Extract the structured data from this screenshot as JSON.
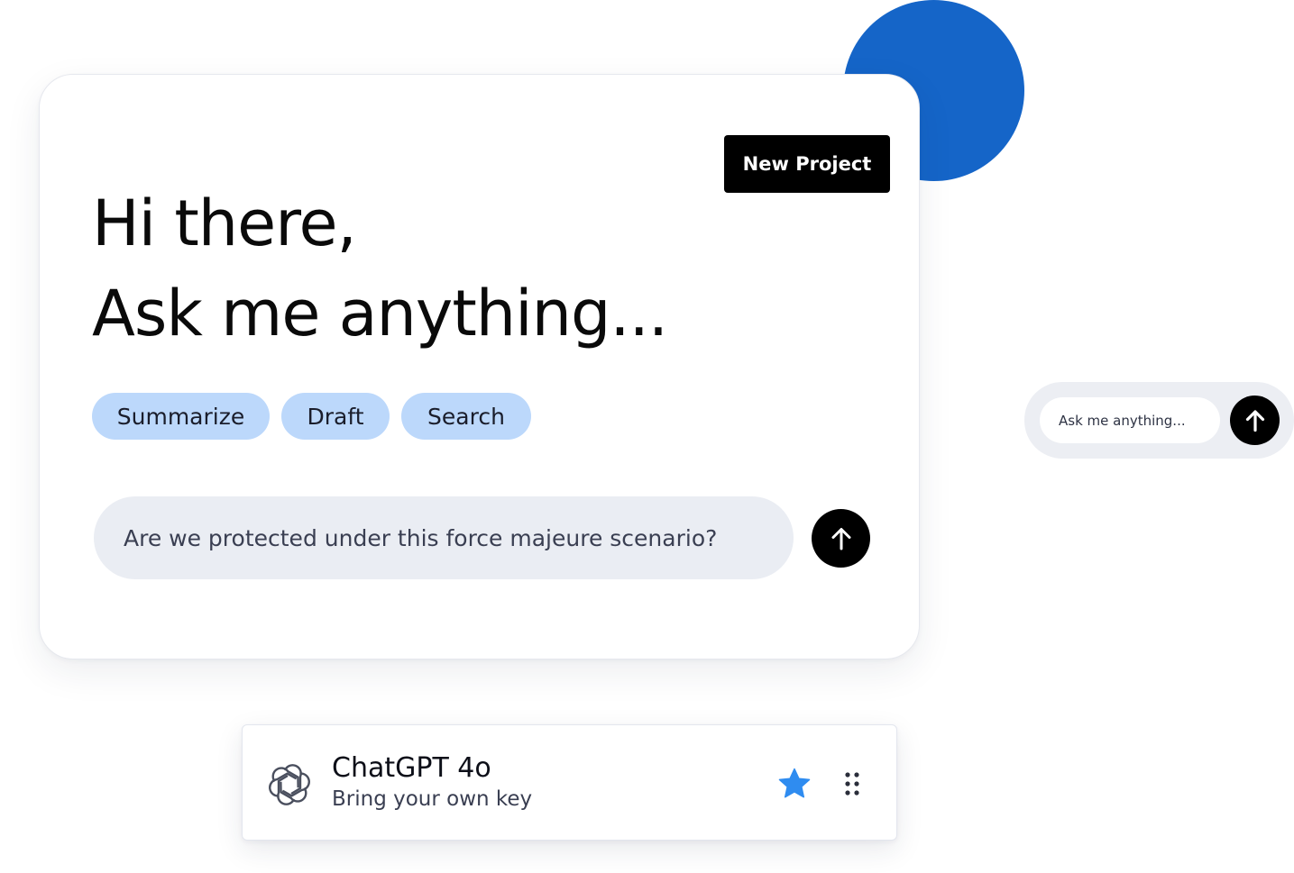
{
  "colors": {
    "accent_circle": "#1565c8",
    "chip_bg": "#bcd8fb",
    "input_bg": "#eaedf3",
    "star": "#2f8cf0"
  },
  "main_card": {
    "new_project_label": "New Project",
    "greeting_line1": "Hi there,",
    "greeting_line2": "Ask me anything...",
    "chips": [
      "Summarize",
      "Draft",
      "Search"
    ],
    "prompt_text": "Are we protected under this force majeure scenario?",
    "send_icon": "arrow-up-icon"
  },
  "mini_bar": {
    "placeholder": "Ask me anything...",
    "send_icon": "arrow-up-icon"
  },
  "model_card": {
    "logo_icon": "openai-logo-icon",
    "name": "ChatGPT 4o",
    "subtitle": "Bring your own key",
    "star_icon": "star-icon",
    "drag_icon": "drag-handle-icon"
  }
}
